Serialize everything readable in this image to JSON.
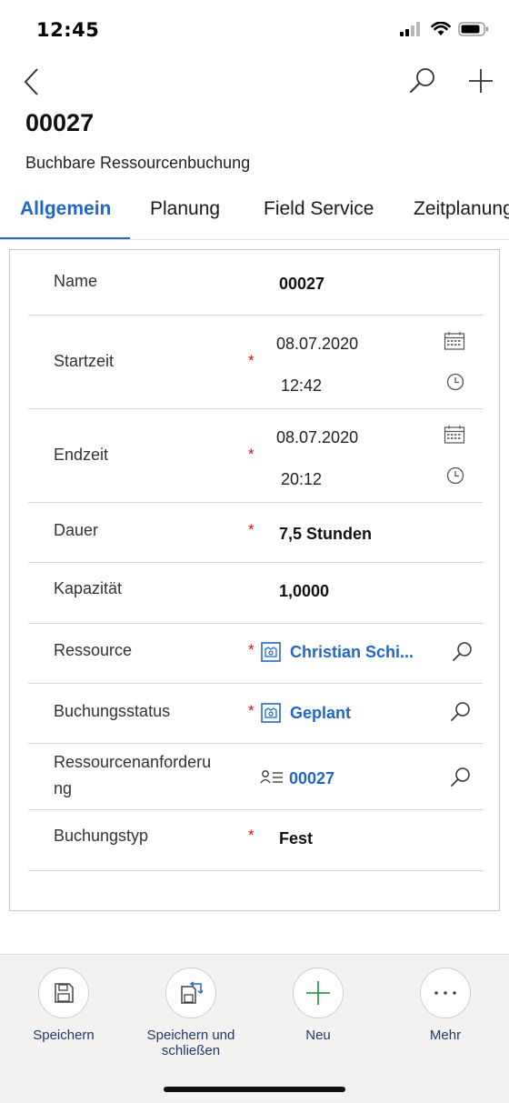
{
  "status_bar": {
    "time": "12:45"
  },
  "header": {
    "record_id": "00027",
    "entity_name": "Buchbare Ressourcenbuchung"
  },
  "tabs": [
    {
      "label": "Allgemein",
      "active": true
    },
    {
      "label": "Planung"
    },
    {
      "label": "Field Service"
    },
    {
      "label": "Zeitplanung"
    }
  ],
  "form": {
    "name": {
      "label": "Name",
      "value": "00027"
    },
    "startzeit": {
      "label": "Startzeit",
      "required": "*",
      "date": "08.07.2020",
      "time": "12:42"
    },
    "endzeit": {
      "label": "Endzeit",
      "required": "*",
      "date": "08.07.2020",
      "time": "20:12"
    },
    "dauer": {
      "label": "Dauer",
      "required": "*",
      "value": "7,5 Stunden"
    },
    "kapazitaet": {
      "label": "Kapazität",
      "value": "1,0000"
    },
    "ressource": {
      "label": "Ressource",
      "required": "*",
      "value": "Christian Schi..."
    },
    "buchungsstatus": {
      "label": "Buchungsstatus",
      "required": "*",
      "value": "Geplant"
    },
    "ressourcenanforderung": {
      "label_line1": "Ressourcenanforderu",
      "label_line2": "ng",
      "value": "00027"
    },
    "buchungstyp": {
      "label": "Buchungstyp",
      "required": "*",
      "value": "Fest"
    }
  },
  "commands": [
    {
      "label": "Speichern",
      "icon": "save-icon"
    },
    {
      "label_line1": "Speichern und",
      "label_line2": "schließen",
      "icon": "save-close-icon"
    },
    {
      "label": "Neu",
      "icon": "plus-icon"
    },
    {
      "label": "Mehr",
      "icon": "more-icon"
    }
  ],
  "colors": {
    "accent": "#2266c9",
    "required": "#dd1111",
    "new_green": "#2e9e4f"
  }
}
